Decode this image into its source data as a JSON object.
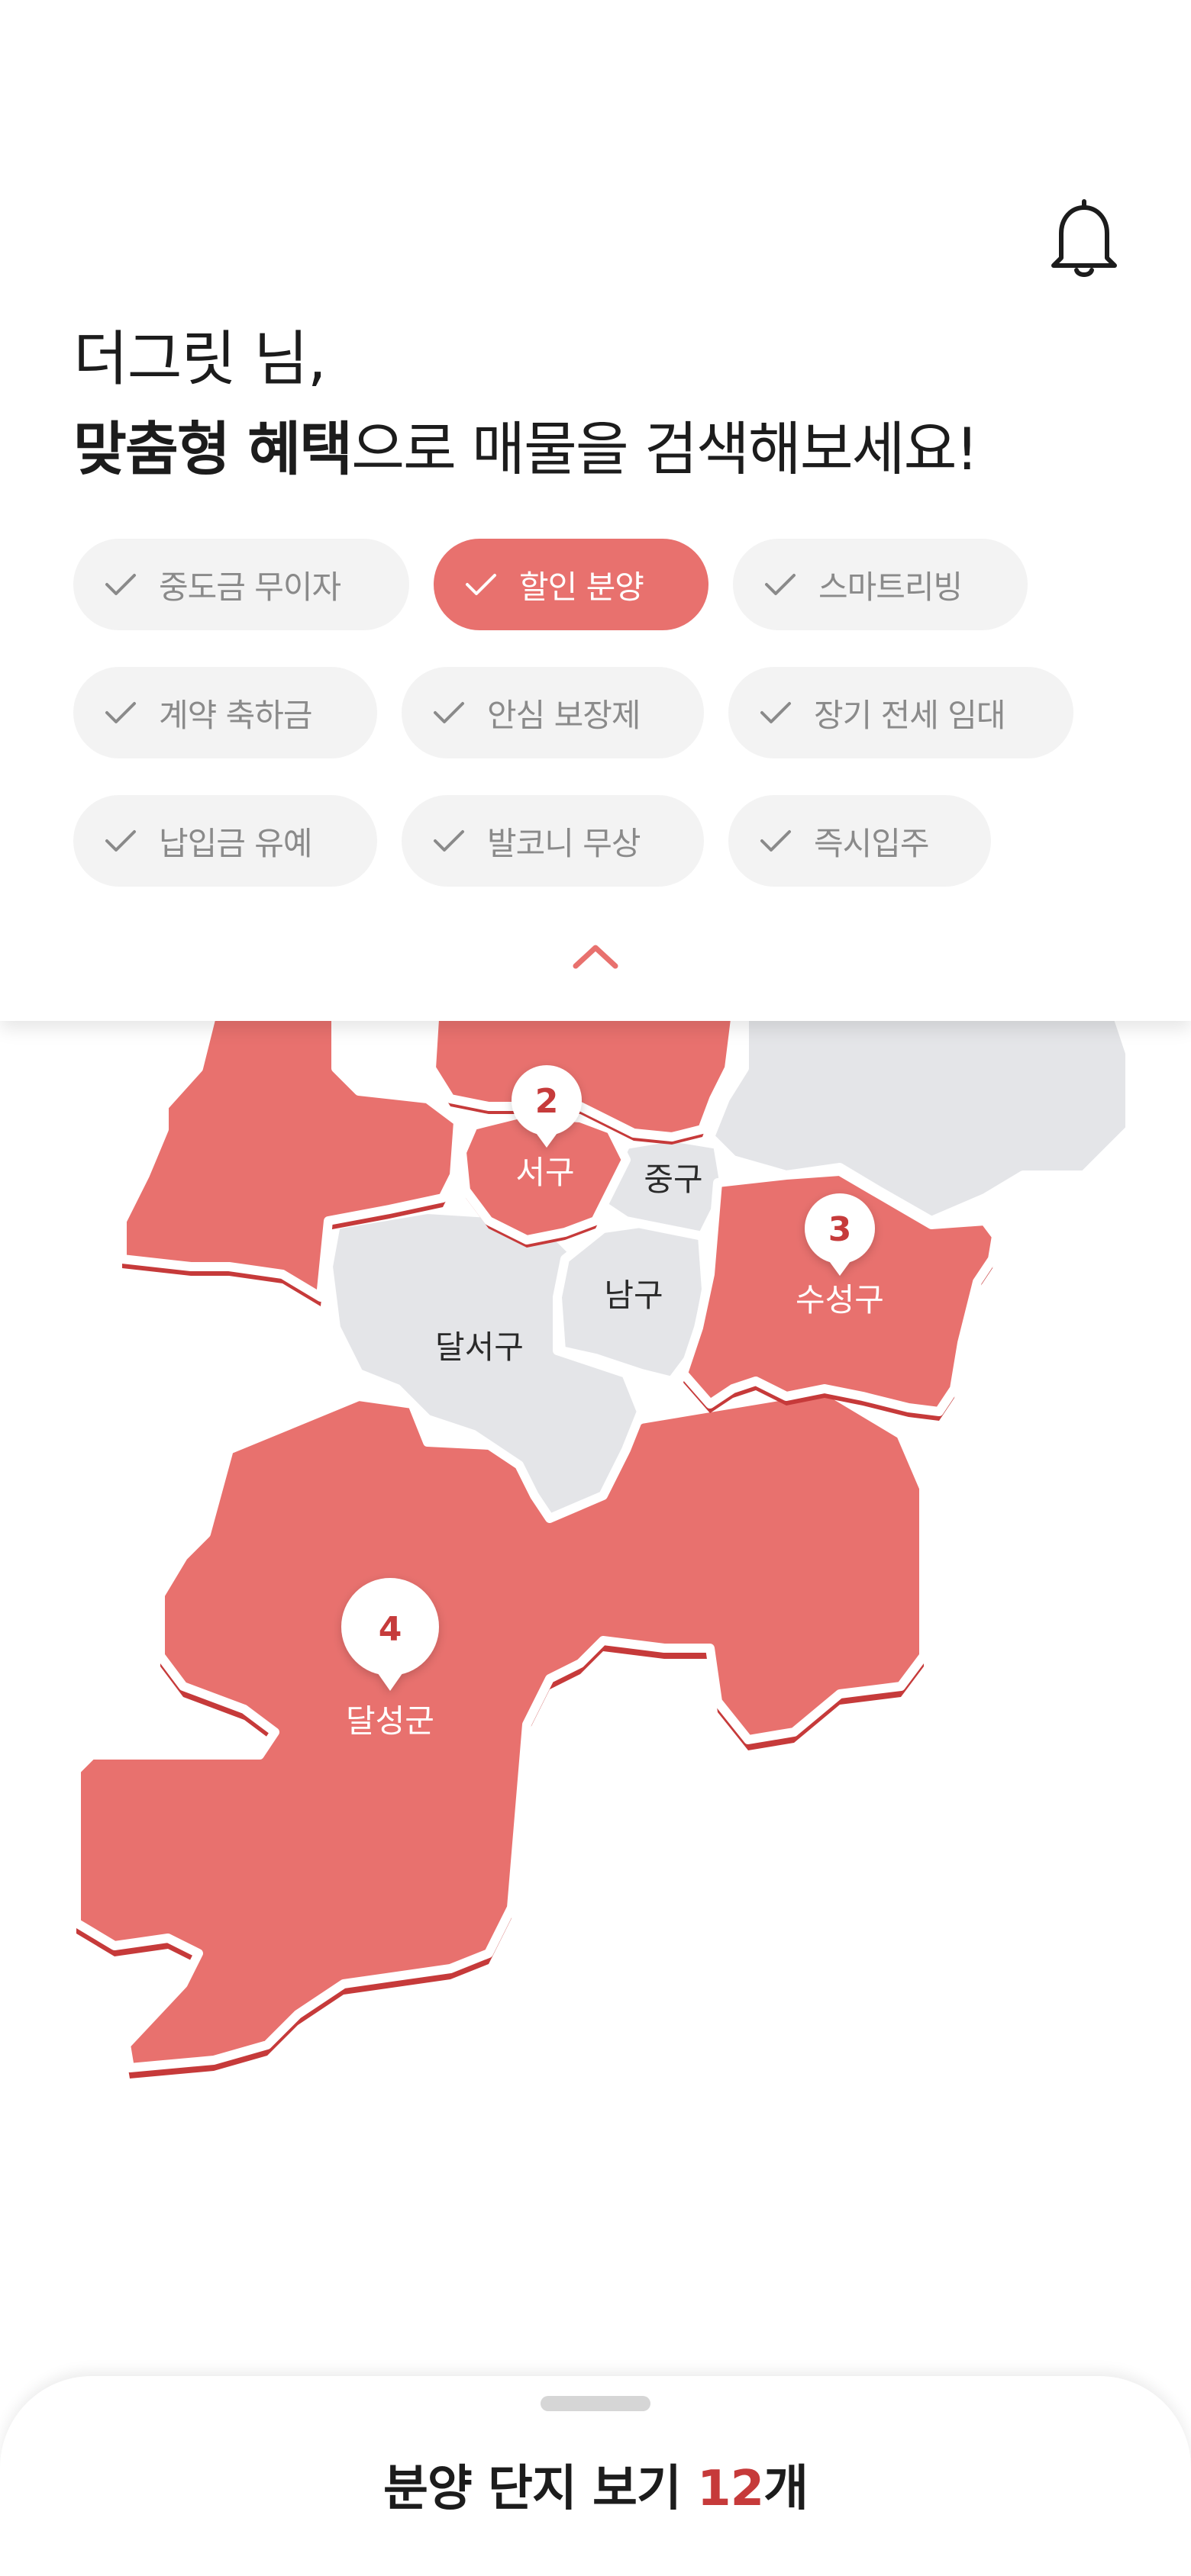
{
  "header": {
    "greeting": "더그릿 님,",
    "subtitle_emphasis": "맞춤형 혜택",
    "subtitle_rest": "으로 매물을 검색해보세요!"
  },
  "filters": [
    {
      "label": "중도금 무이자",
      "selected": false
    },
    {
      "label": "할인 분양",
      "selected": true
    },
    {
      "label": "스마트리빙",
      "selected": false
    },
    {
      "label": "계약 축하금",
      "selected": false
    },
    {
      "label": "안심 보장제",
      "selected": false
    },
    {
      "label": "장기 전세 임대",
      "selected": false
    },
    {
      "label": "납입금 유예",
      "selected": false
    },
    {
      "label": "발코니 무상",
      "selected": false
    },
    {
      "label": "즉시입주",
      "selected": false
    }
  ],
  "map": {
    "districts": [
      {
        "name": "서구",
        "count": "2",
        "highlighted": true
      },
      {
        "name": "중구",
        "highlighted": false
      },
      {
        "name": "수성구",
        "count": "3",
        "highlighted": true
      },
      {
        "name": "남구",
        "highlighted": false
      },
      {
        "name": "달서구",
        "highlighted": false
      },
      {
        "name": "달성군",
        "count": "4",
        "highlighted": true
      }
    ]
  },
  "bottom_sheet": {
    "cta_prefix": "분양 단지 보기 ",
    "cta_count": "12",
    "cta_suffix": "개"
  },
  "colors": {
    "accent": "#e8716e",
    "accent_dark": "#c63a3a",
    "inactive_region": "#e4e5e8"
  },
  "icons": {
    "bell": "bell-icon",
    "check": "check-icon",
    "collapse": "chevron-up-icon"
  }
}
